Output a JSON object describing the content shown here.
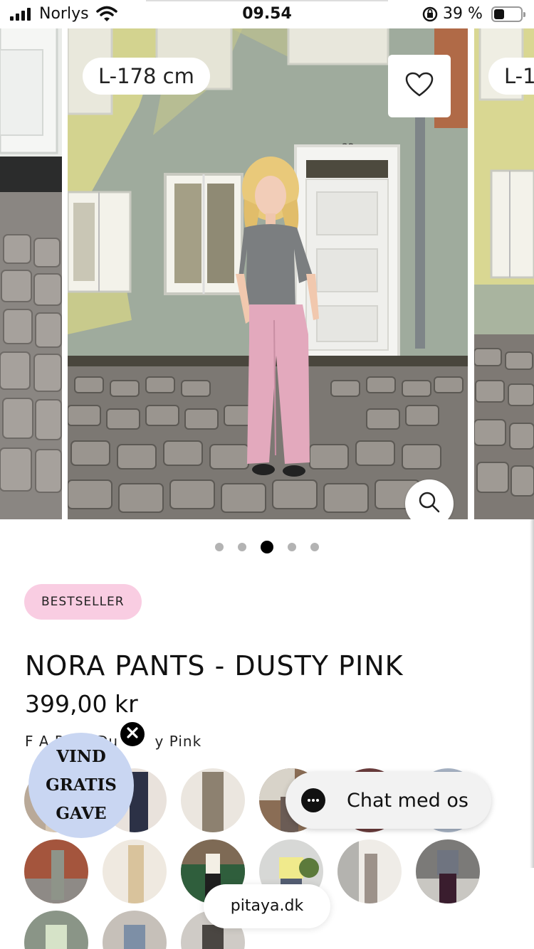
{
  "status_bar": {
    "carrier": "Norlys",
    "time": "09.54",
    "battery_percent": "39 %",
    "battery_level": 0.39,
    "icons": [
      "signal-icon",
      "wifi-icon",
      "rotation-lock-icon",
      "battery-icon"
    ]
  },
  "gallery": {
    "size_tag_main": "L-178 cm",
    "size_tag_next": "L-1",
    "active_index": 3,
    "total": 5,
    "house_number": "32",
    "icons": {
      "favorite": "heart-icon",
      "zoom": "search-icon"
    }
  },
  "product": {
    "badge": "BESTSELLER",
    "title": "NORA PANTS - DUSTY PINK",
    "price": "399,00 kr",
    "color_line": "F A R      Du       y Pink"
  },
  "swatches": {
    "row1": [
      "variant-1",
      "variant-2",
      "variant-3",
      "variant-4",
      "variant-5",
      "variant-6"
    ],
    "row2": [
      "variant-7",
      "variant-8",
      "variant-9",
      "variant-10",
      "variant-11",
      "variant-12"
    ],
    "row3": [
      "variant-13",
      "variant-14",
      "variant-15"
    ]
  },
  "promo": {
    "line1": "VIND",
    "line2": "GRATIS",
    "line3": "GAVE",
    "color": "#c9d6f2"
  },
  "chat": {
    "label": "Chat med os",
    "icon": "chat-bubble-icon"
  },
  "browser": {
    "domain": "pitaya.dk"
  },
  "colors": {
    "badge_bg": "#f9cde2",
    "wall": "#9fab9d",
    "pants": "#e3a9bd"
  }
}
